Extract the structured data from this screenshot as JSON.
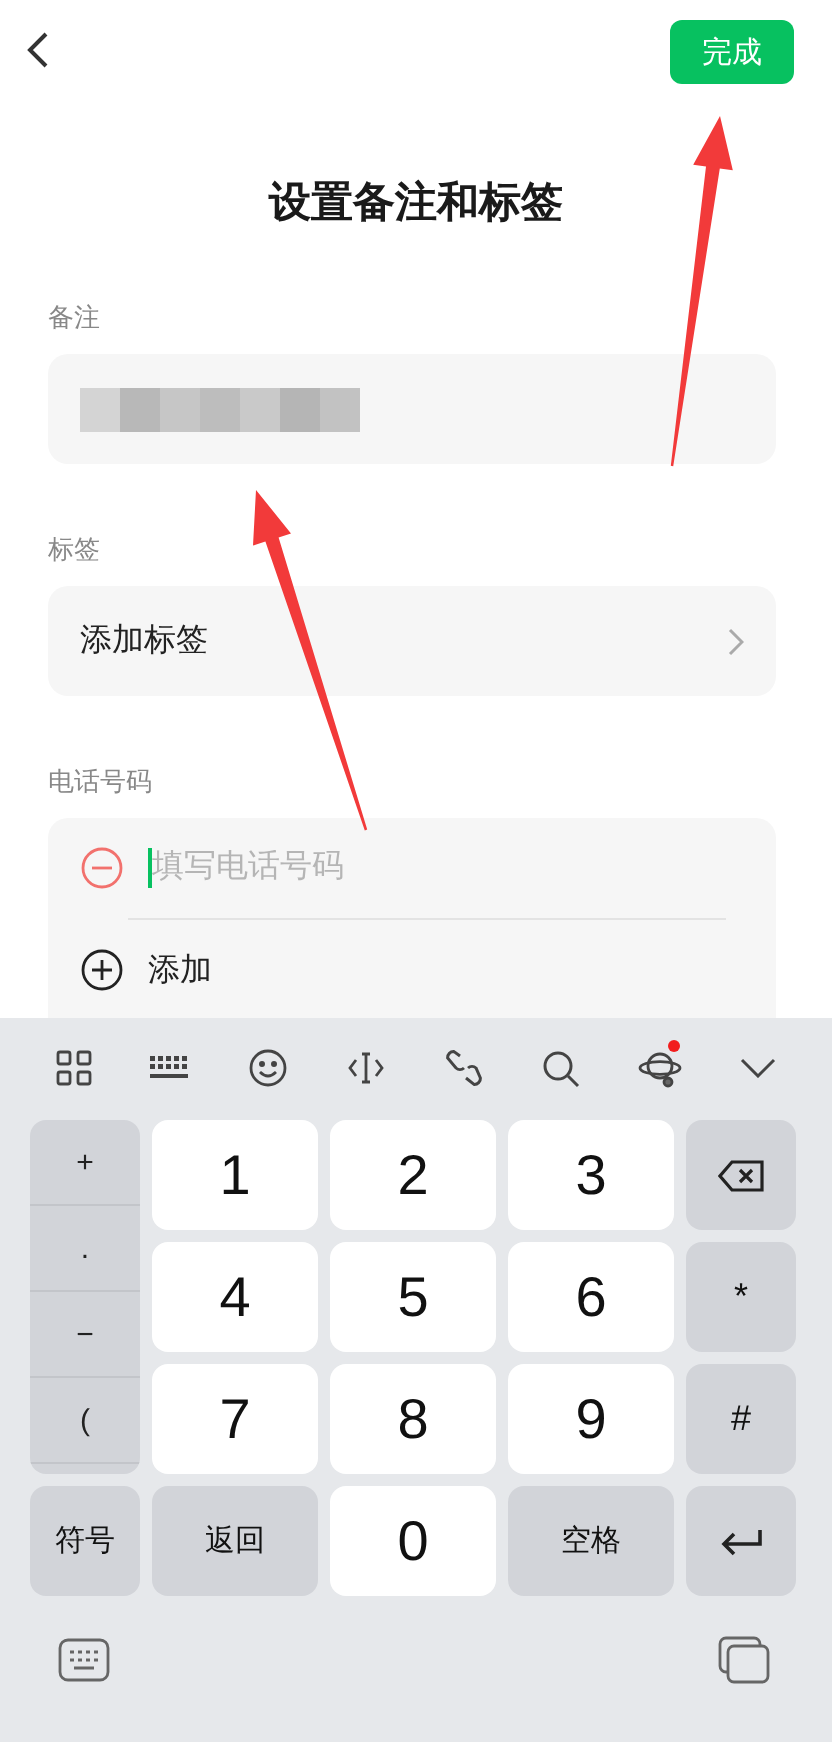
{
  "nav": {
    "done_button": "完成"
  },
  "title": "设置备注和标签",
  "remark": {
    "label": "备注",
    "redacted": true
  },
  "tags": {
    "label": "标签",
    "action": "添加标签"
  },
  "phone": {
    "label": "电话号码",
    "placeholder": "填写电话号码",
    "focused": true,
    "add_label": "添加"
  },
  "keyboard": {
    "toolbar": [
      {
        "kind": "grid"
      },
      {
        "kind": "keys"
      },
      {
        "kind": "emoji"
      },
      {
        "kind": "cursor"
      },
      {
        "kind": "link"
      },
      {
        "kind": "search"
      },
      {
        "kind": "planet",
        "badge": true
      },
      {
        "kind": "collapse"
      }
    ],
    "symbol_column": [
      "+",
      ".",
      "−",
      "("
    ],
    "rows": [
      [
        "",
        {
          "kind": "digit",
          "label": "1"
        },
        {
          "kind": "digit",
          "label": "2"
        },
        {
          "kind": "digit",
          "label": "3"
        },
        {
          "kind": "backspace"
        }
      ],
      [
        "",
        {
          "kind": "digit",
          "label": "4"
        },
        {
          "kind": "digit",
          "label": "5"
        },
        {
          "kind": "digit",
          "label": "6"
        },
        {
          "kind": "symbol",
          "label": "*"
        }
      ],
      [
        "",
        {
          "kind": "digit",
          "label": "7"
        },
        {
          "kind": "digit",
          "label": "8"
        },
        {
          "kind": "digit",
          "label": "9"
        },
        {
          "kind": "symbol",
          "label": "#"
        }
      ],
      [
        {
          "kind": "function",
          "label": "符号"
        },
        {
          "kind": "function",
          "label": "返回"
        },
        {
          "kind": "digit",
          "label": "0"
        },
        {
          "kind": "function",
          "label": "空格"
        },
        {
          "kind": "enter"
        }
      ]
    ],
    "bottom_bar": [
      {
        "kind": "keyboard"
      },
      {
        "kind": "clipboard"
      }
    ]
  },
  "annotations": [
    {
      "kind": "arrow"
    },
    {
      "kind": "arrow"
    }
  ]
}
